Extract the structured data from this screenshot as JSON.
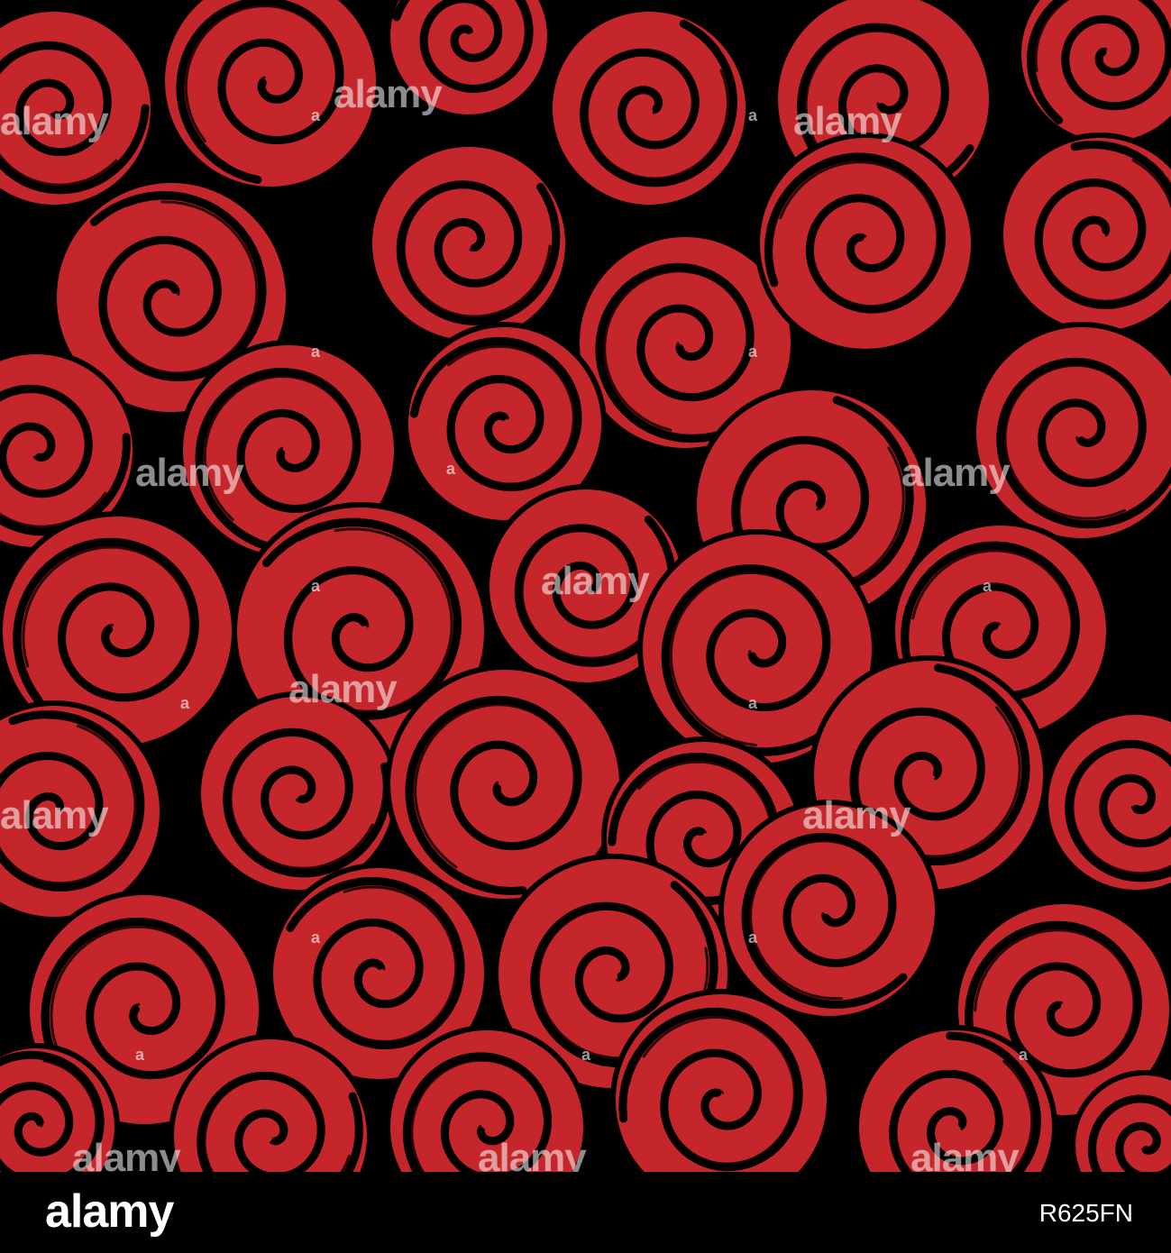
{
  "image": {
    "description_colors": {
      "background": "#c4262b",
      "ink": "#000000",
      "footer": "#000000"
    }
  },
  "watermark": {
    "text": "alamy",
    "mark": "a"
  },
  "footer": {
    "logo": "alamy",
    "image_id": "R625FN"
  }
}
